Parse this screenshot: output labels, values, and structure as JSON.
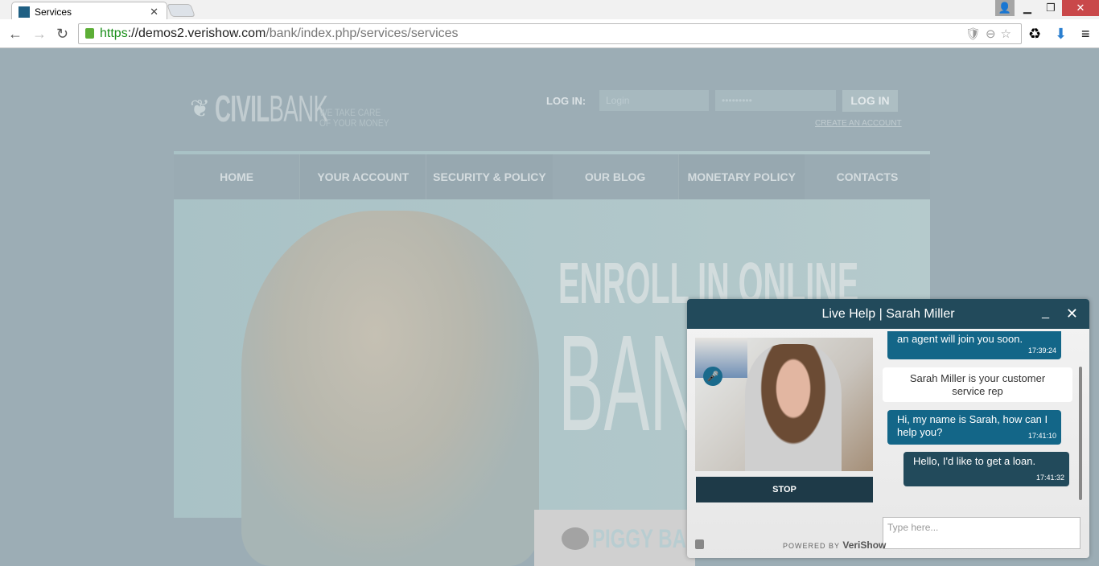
{
  "browser": {
    "tab_title": "Services",
    "url_scheme": "https",
    "url_host": "://demos2.verishow.com",
    "url_path": "/bank/index.php/services/services"
  },
  "site": {
    "logo_civil": "CIVIL",
    "logo_bank": "BANK",
    "tagline_1": "WE TAKE CARE",
    "tagline_2": "OF YOUR MONEY",
    "login_label": "LOG IN:",
    "login_placeholder": "Login",
    "password_placeholder": "•••••••••",
    "login_button": "LOG IN",
    "create_account": "CREATE AN ACCOUNT",
    "menu": [
      {
        "label": "HOME"
      },
      {
        "label": "YOUR ACCOUNT"
      },
      {
        "label": "SECURITY & POLICY"
      },
      {
        "label": "OUR BLOG"
      },
      {
        "label": "MONETARY POLICY"
      },
      {
        "label": "CONTACTS"
      }
    ],
    "headline_1": "ENROLL IN ONLINE",
    "headline_2": "BANK",
    "promo": "PIGGY BA"
  },
  "widget": {
    "title": "Live Help | Sarah Miller",
    "stop_label": "STOP",
    "messages": [
      {
        "text": "an agent will join you soon.",
        "time": "17:39:24"
      },
      {
        "text": "Sarah Miller is your customer service rep"
      },
      {
        "text": "Hi, my name is Sarah, how can I help you?",
        "time": "17:41:10"
      },
      {
        "text": "Hello, I'd like to get a loan.",
        "time": "17:41:32"
      }
    ],
    "input_placeholder": "Type here...",
    "powered_by": "POWERED BY",
    "brand": "VeriShow"
  }
}
